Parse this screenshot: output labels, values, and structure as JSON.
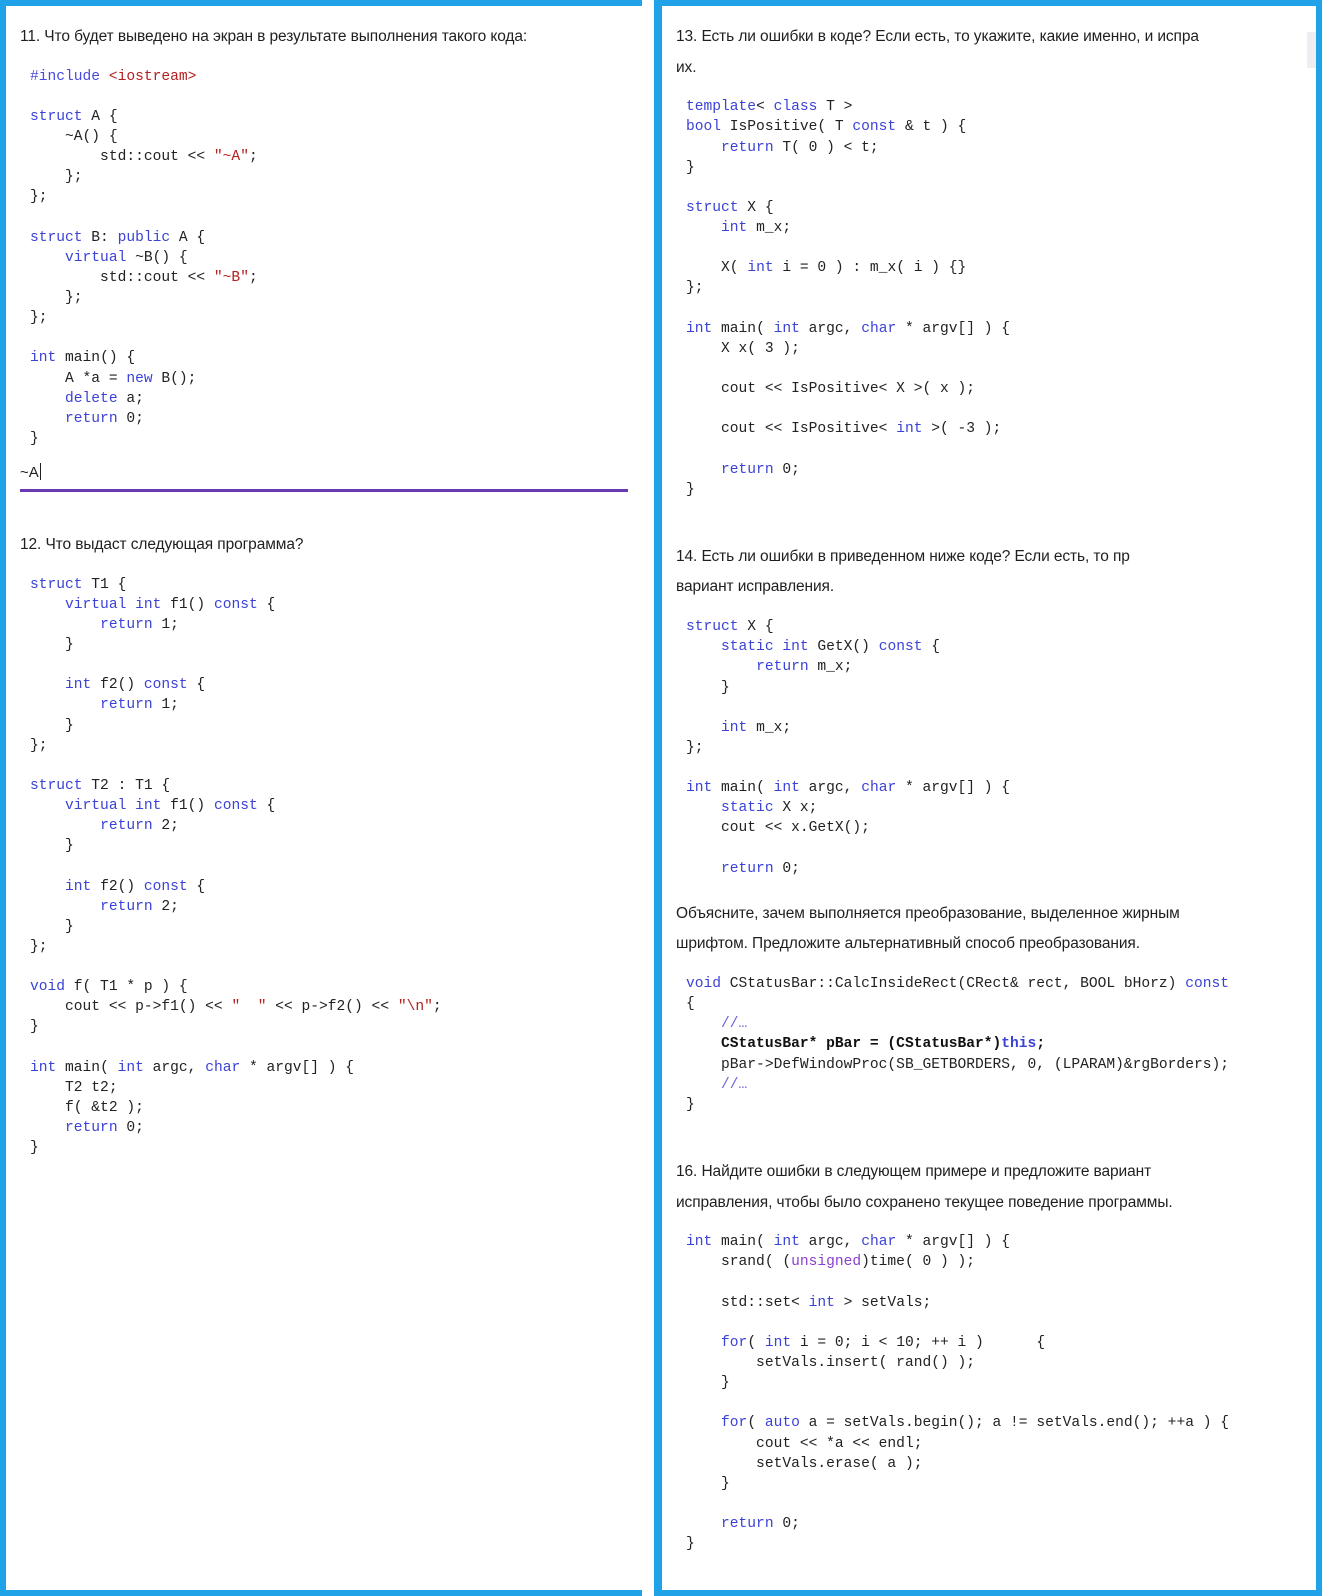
{
  "theme": {
    "panel_border_color": "#1fa2e8",
    "input_underline_color": "#6a3ab2",
    "keyword_color": "#3b42d6",
    "string_color": "#b32020",
    "magenta_keyword_color": "#8a3fd1",
    "comment_color": "#6c63d8",
    "page_background": "#ffffff"
  },
  "left_column": {
    "q11": {
      "prompt": "11. Что будет выведено на экран в результате выполнения такого кода:",
      "code_lines": [
        "#include <iostream>",
        "",
        "struct A {",
        "    ~A() {",
        "        std::cout << \"~A\";",
        "    };",
        "};",
        "",
        "struct B: public A {",
        "    virtual ~B() {",
        "        std::cout << \"~B\";",
        "    };",
        "};",
        "",
        "int main() {",
        "    A *a = new B();",
        "    delete a;",
        "    return 0;",
        "}"
      ],
      "answer_value": "~A",
      "answer_placeholder": ""
    },
    "q12": {
      "prompt": "12. Что выдаст следующая программа?",
      "code_lines": [
        "struct T1 {",
        "    virtual int f1() const {",
        "        return 1;",
        "    }",
        "",
        "    int f2() const {",
        "        return 1;",
        "    }",
        "};",
        "",
        "struct T2 : T1 {",
        "    virtual int f1() const {",
        "        return 2;",
        "    }",
        "",
        "    int f2() const {",
        "        return 2;",
        "    }",
        "};",
        "",
        "void f( T1 * p ) {",
        "    cout << p->f1() << \"  \" << p->f2() << \"\\n\";",
        "}",
        "",
        "int main( int argc, char * argv[] ) {",
        "    T2 t2;",
        "    f( &t2 );",
        "    return 0;",
        "}"
      ]
    }
  },
  "right_column": {
    "q13": {
      "prompt_line1": "13. Есть ли ошибки в коде? Если есть, то укажите, какие именно, и испра",
      "prompt_line2": "их.",
      "code_lines": [
        "template< class T >",
        "bool IsPositive( T const & t ) {",
        "    return T( 0 ) < t;",
        "}",
        "",
        "struct X {",
        "    int m_x;",
        "",
        "    X( int i = 0 ) : m_x( i ) {}",
        "};",
        "",
        "int main( int argc, char * argv[] ) {",
        "    X x( 3 );",
        "",
        "    cout << IsPositive< X >( x );",
        "",
        "    cout << IsPositive< int >( -3 );",
        "",
        "    return 0;",
        "}"
      ]
    },
    "q14": {
      "prompt_line1": "14. Есть ли ошибки в приведенном ниже коде? Если есть, то пр",
      "prompt_line2": "вариант исправления.",
      "code_lines": [
        "struct X {",
        "    static int GetX() const {",
        "        return m_x;",
        "    }",
        "",
        "    int m_x;",
        "};",
        "",
        "int main( int argc, char * argv[] ) {",
        "    static X x;",
        "    cout << x.GetX();",
        "",
        "    return 0;"
      ],
      "followup_line1": "Объясните, зачем выполняется преобразование, выделенное жирным",
      "followup_line2": "шрифтом. Предложите альтернативный способ преобразования.",
      "statusbar_code_lines": [
        "void CStatusBar::CalcInsideRect(CRect& rect, BOOL bHorz) const",
        "{",
        "    //…",
        "    CStatusBar* pBar = (CStatusBar*)this;",
        "    pBar->DefWindowProc(SB_GETBORDERS, 0, (LPARAM)&rgBorders);",
        "    //…",
        "}"
      ]
    },
    "q16": {
      "prompt_line1": "16. Найдите ошибки в следующем примере и предложите вариант",
      "prompt_line2": "исправления, чтобы было сохранено текущее поведение программы.",
      "code_lines": [
        "int main( int argc, char * argv[] ) {",
        "    srand( (unsigned)time( 0 ) );",
        "",
        "    std::set< int > setVals;",
        "",
        "    for( int i = 0; i < 10; ++ i )      {",
        "        setVals.insert( rand() );",
        "    }",
        "",
        "    for( auto a = setVals.begin(); a != setVals.end(); ++a ) {",
        "        cout << *a << endl;",
        "        setVals.erase( a );",
        "    }",
        "",
        "    return 0;",
        "}"
      ]
    }
  }
}
